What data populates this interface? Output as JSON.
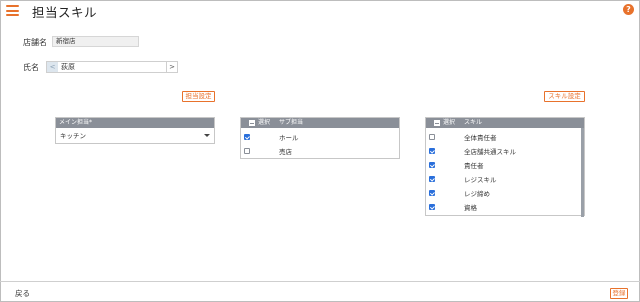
{
  "header": {
    "title": "担当スキル",
    "help_icon": "?"
  },
  "store": {
    "label": "店舗名",
    "value": "新宿店"
  },
  "person": {
    "label": "氏名",
    "prev": "<",
    "value": "荻原",
    "next": ">"
  },
  "buttons": {
    "assign_settings": "担当設定",
    "skill_settings": "スキル設定",
    "register": "登録"
  },
  "main_panel": {
    "header": "メイン担当*",
    "selected": "キッチン"
  },
  "sub_panel": {
    "col_select": "選択",
    "col_name": "サブ担当",
    "rows": [
      {
        "label": "ホール",
        "checked": true
      },
      {
        "label": "売店",
        "checked": false
      }
    ]
  },
  "skill_panel": {
    "col_select": "選択",
    "col_name": "スキル",
    "rows": [
      {
        "label": "全体責任者",
        "checked": false
      },
      {
        "label": "全店舗共通スキル",
        "checked": true
      },
      {
        "label": "責任者",
        "checked": true
      },
      {
        "label": "レジスキル",
        "checked": true
      },
      {
        "label": "レジ締め",
        "checked": true
      },
      {
        "label": "資格",
        "checked": true
      }
    ]
  },
  "footer": {
    "back": "戻る"
  },
  "colors": {
    "accent": "#e8722c",
    "header_gray": "#8a8f98",
    "checkbox_blue": "#2a6fdb"
  }
}
